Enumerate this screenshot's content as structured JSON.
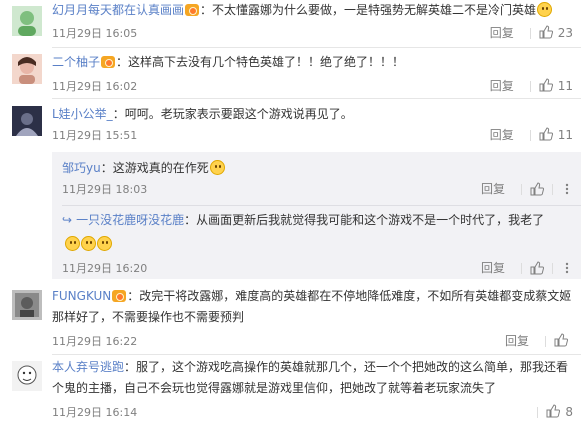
{
  "comments": [
    {
      "user": "幻月月每天都在认真画画",
      "text": "不太懂露娜为什么要做，一是特强势无解英雄二不是冷门英雄",
      "time": "11月29日 16:05",
      "reply_label": "回复",
      "likes": "23",
      "avatar_color": "#7fbf7f"
    },
    {
      "user": "二个柚子",
      "text": "这样高下去没有几个特色英雄了！！绝了绝了！！！",
      "time": "11月29日 16:02",
      "reply_label": "回复",
      "likes": "11",
      "avatar_color": "#e8b6a8"
    },
    {
      "user": "L娃小公举_",
      "text": "呵呵。老玩家表示要跟这个游戏说再见了。",
      "time": "11月29日 15:51",
      "reply_label": "回复",
      "likes": "11",
      "avatar_color": "#3a3f56"
    },
    {
      "user": "FUNGKUN",
      "text": "改完干将改露娜，难度高的英雄都在不停地降低难度，不如所有英雄都变成蔡文姬那样好了，不需要操作也不需要预判",
      "time": "11月29日 16:22",
      "reply_label": "回复",
      "likes": "",
      "avatar_color": "#9a9a9a"
    },
    {
      "user": "本人弃号逃跑",
      "text": "服了，这个游戏吃高操作的英雄就那几个，还一个个把她改的这么简单，那我还看个鬼的主播，自己不会玩也觉得露娜就是游戏里信仰，把她改了就等着老玩家流失了",
      "time": "11月29日 16:14",
      "reply_label": "",
      "likes": "8",
      "avatar_color": "#dcdcdc"
    }
  ],
  "sub_replies": [
    {
      "user": "邹巧yu",
      "text": "这游戏真的在作死",
      "time": "11月29日 18:03",
      "reply_label": "回复"
    },
    {
      "user": "一只没花鹿呀没花鹿",
      "text": "从画面更新后我就觉得我可能和这个游戏不是一个时代了，我老了",
      "time": "11月29日 16:20",
      "reply_label": "回复"
    }
  ],
  "icons": {
    "like": "thumbs-up-icon",
    "more": "more-dots-icon",
    "vip": "vip-badge-icon",
    "emoji": "emoji-icon"
  },
  "colors": {
    "username": "#5a80c7",
    "meta": "#808080",
    "sub_bg": "#f2f2f5"
  }
}
